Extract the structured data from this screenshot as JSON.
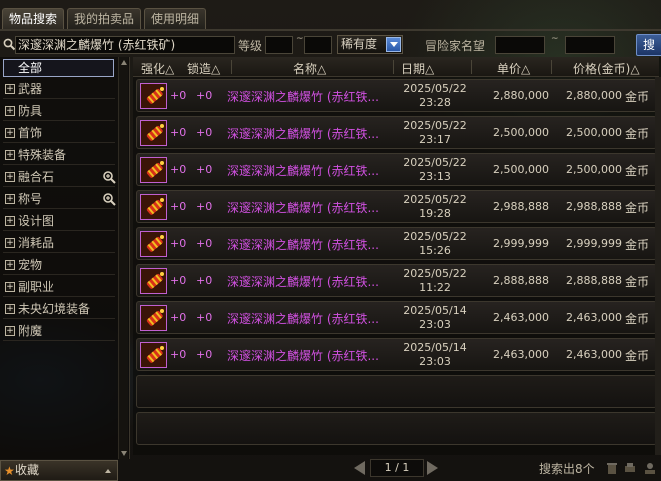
{
  "tabs": [
    {
      "label": "物品搜索",
      "active": true
    },
    {
      "label": "我的拍卖品",
      "active": false
    },
    {
      "label": "使用明细",
      "active": false
    }
  ],
  "search": {
    "value": "深邃深渊之麟爆竹 (赤红铁矿)",
    "level_label": "等级",
    "level_sep": "~",
    "rarity_value": "稀有度",
    "adventurer_label": "冒险家名望",
    "adventurer_sep": "~",
    "search_button": "搜索"
  },
  "sidebar": {
    "all_label": "全部",
    "categories": [
      {
        "label": "武器",
        "zoom": false
      },
      {
        "label": "防具",
        "zoom": false
      },
      {
        "label": "首饰",
        "zoom": false
      },
      {
        "label": "特殊装备",
        "zoom": false
      },
      {
        "label": "融合石",
        "zoom": true
      },
      {
        "label": "称号",
        "zoom": true
      },
      {
        "label": "设计图",
        "zoom": false
      },
      {
        "label": "消耗品",
        "zoom": false
      },
      {
        "label": "宠物",
        "zoom": false
      },
      {
        "label": "副职业",
        "zoom": false
      },
      {
        "label": "未央幻境装备",
        "zoom": false
      },
      {
        "label": "附魔",
        "zoom": false
      }
    ],
    "favorites_label": "收藏"
  },
  "table": {
    "headers": {
      "strengthen": "强化△",
      "lock": "锁造△",
      "name": "名称△",
      "date": "日期△",
      "unit_price": "单价△",
      "price": "价格(金币)△"
    },
    "rows": [
      {
        "str": "+0",
        "lock": "+0",
        "name": "深邃深渊之麟爆竹 (赤红铁...",
        "date": "2025/05/22",
        "time": "23:28",
        "unit": "2,880,000",
        "price": "2,880,000",
        "currency": "金币"
      },
      {
        "str": "+0",
        "lock": "+0",
        "name": "深邃深渊之麟爆竹 (赤红铁...",
        "date": "2025/05/22",
        "time": "23:17",
        "unit": "2,500,000",
        "price": "2,500,000",
        "currency": "金币"
      },
      {
        "str": "+0",
        "lock": "+0",
        "name": "深邃深渊之麟爆竹 (赤红铁...",
        "date": "2025/05/22",
        "time": "23:13",
        "unit": "2,500,000",
        "price": "2,500,000",
        "currency": "金币"
      },
      {
        "str": "+0",
        "lock": "+0",
        "name": "深邃深渊之麟爆竹 (赤红铁...",
        "date": "2025/05/22",
        "time": "19:28",
        "unit": "2,988,888",
        "price": "2,988,888",
        "currency": "金币"
      },
      {
        "str": "+0",
        "lock": "+0",
        "name": "深邃深渊之麟爆竹 (赤红铁...",
        "date": "2025/05/22",
        "time": "15:26",
        "unit": "2,999,999",
        "price": "2,999,999",
        "currency": "金币"
      },
      {
        "str": "+0",
        "lock": "+0",
        "name": "深邃深渊之麟爆竹 (赤红铁...",
        "date": "2025/05/22",
        "time": "11:22",
        "unit": "2,888,888",
        "price": "2,888,888",
        "currency": "金币"
      },
      {
        "str": "+0",
        "lock": "+0",
        "name": "深邃深渊之麟爆竹 (赤红铁...",
        "date": "2025/05/14",
        "time": "23:03",
        "unit": "2,463,000",
        "price": "2,463,000",
        "currency": "金币"
      },
      {
        "str": "+0",
        "lock": "+0",
        "name": "深邃深渊之麟爆竹 (赤红铁...",
        "date": "2025/05/14",
        "time": "23:03",
        "unit": "2,463,000",
        "price": "2,463,000",
        "currency": "金币"
      }
    ]
  },
  "pager": {
    "text": "1 / 1"
  },
  "result_text": "搜索出8个",
  "colors": {
    "item_name": "#d050e0",
    "accent_blue": "#2a58a8",
    "favorite_star": "#e8902a"
  }
}
